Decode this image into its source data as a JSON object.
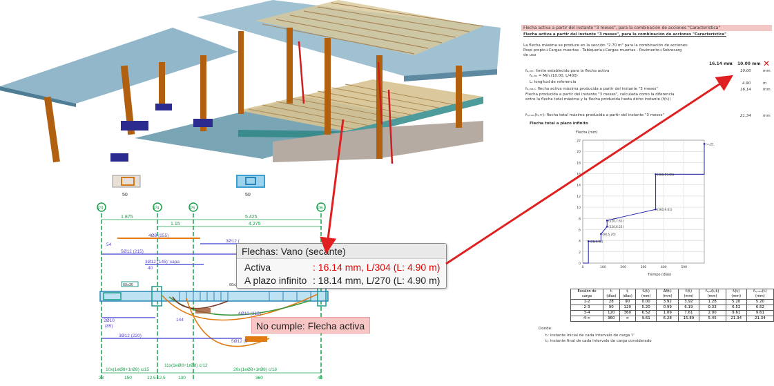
{
  "tooltip": {
    "title": "Flechas: Vano (secante)",
    "rows": [
      {
        "label": "Activa",
        "value": ": 16.14 mm, L/304 (L: 4.90 m)",
        "color": "#e00000"
      },
      {
        "label": "A plazo infinito",
        "value": ": 18.14 mm, L/270 (L: 4.90 m)",
        "color": "#222222"
      }
    ]
  },
  "status_badge": "No cumple: Flecha activa",
  "report": {
    "header": "Flecha activa a partir del instante \"3 meses\", para la combinación de acciones \"Característica\"",
    "subtitle": "Flecha activa a partir del instante \"3 meses\", para la combinación de acciones \"Característica\"",
    "intro_1": "La flecha máxima se produce en la sección \"2.70 m\" para la combinación de acciones:",
    "intro_2": "Peso propio+Cargas muertas - Tabiquería+Cargas muertas - Pavimento+Sobrecarg",
    "intro_3": "de uso",
    "check_left": "16.14 mm",
    "check_op": "≤",
    "check_right": "10.00 mm",
    "fail_mark": "✕",
    "lines": [
      "fₐ,ₗᵢₘ: límite establecido para la flecha activa",
      "fₐ,ₗᵢₘ = Mín.(10.00, L/400)",
      "L: longitud de referencia",
      "fₐ,ₘₐₓ: flecha activa máxima producida a partir del instante \"3 meses\"",
      "Flecha producida a partir del instante \"3 meses\", calculada como la diferencia",
      "entre la flecha total máxima y la flecha producida hasta dicho instante (f(tᵢ))",
      "fₜ,ₘₐₓ(tᵢ,∞): flecha total máxima producida a partir del instante \"3 meses\"",
      "Flecha total a plazo infinito"
    ],
    "right_vals": [
      "10.00",
      "4.90",
      "16.14",
      "21.34"
    ],
    "right_units": [
      "mm",
      "m",
      "mm",
      "mm"
    ],
    "chart_ylabel": "Flecha (mm)",
    "chart_xlabel": "Tiempo (días)",
    "footer_1": "Donde:",
    "footer_2": "tᵢ: instante inicial de cada intervalo de carga 'i'",
    "footer_3": "tⱼ: instante final de cada intervalo de carga considerado"
  },
  "chart_data": {
    "type": "line",
    "title": "",
    "xlabel": "Tiempo (días)",
    "ylabel": "Flecha (mm)",
    "xlim": [
      0,
      600
    ],
    "ylim": [
      0,
      22
    ],
    "xticks": [
      0,
      100,
      200,
      300,
      400,
      500
    ],
    "yticks": [
      0,
      2,
      4,
      6,
      8,
      10,
      12,
      14,
      16,
      18,
      20,
      22
    ],
    "series": [
      {
        "values": [
          [
            0,
            0
          ],
          [
            28,
            0
          ],
          [
            28,
            3.92
          ],
          [
            90,
            3.92
          ],
          [
            90,
            5.2
          ],
          [
            120,
            6.52
          ],
          [
            120,
            7.61
          ],
          [
            200,
            8.3
          ],
          [
            360,
            9.61
          ],
          [
            360,
            15.89
          ],
          [
            600,
            15.89
          ],
          [
            600,
            21.34
          ]
        ]
      }
    ],
    "labels": [
      {
        "x": 28,
        "y": 3.92,
        "text": "(28,3.92)"
      },
      {
        "x": 90,
        "y": 5.2,
        "text": "(90,5.20)"
      },
      {
        "x": 120,
        "y": 6.52,
        "text": "(120,6.52)"
      },
      {
        "x": 120,
        "y": 7.61,
        "text": "(120,7.61)"
      },
      {
        "x": 360,
        "y": 9.61,
        "text": "(360,9.61)"
      },
      {
        "x": 360,
        "y": 15.89,
        "text": "(360,15.89)"
      },
      {
        "x": 600,
        "y": 21.34,
        "text": "(∞,21.34)"
      }
    ]
  },
  "steps_table": {
    "headers": [
      "Escalón de carga",
      "tᵢ (días)",
      "tⱼ (días)",
      "fₐ(tᵢ) (mm)",
      "Δf(tᵢ) (mm)",
      "fᵢ(tⱼ) (mm)",
      "fₐ,ₐᵢ(tᵢ,tⱼ) (mm)",
      "fₜ(tⱼ) (mm)",
      "fₐ,ₘₐₓ(tᵢ) (mm)"
    ],
    "rows": [
      [
        "1-2",
        "28",
        "90",
        "0.00",
        "3.92",
        "3.92",
        "1.28",
        "5.20",
        "5.20"
      ],
      [
        "2-3",
        "90",
        "120",
        "5.20",
        "0.99",
        "6.19",
        "0.33",
        "6.52",
        "6.52"
      ],
      [
        "3-4",
        "120",
        "360",
        "6.52",
        "1.09",
        "7.61",
        "2.00",
        "9.61",
        "9.61"
      ],
      [
        "4-∞",
        "360",
        "∞",
        "9.61",
        "6.28",
        "15.89",
        "5.45",
        "21.34",
        "21.34"
      ]
    ]
  },
  "beam_drawing": {
    "column_labels": [
      "P3",
      "P4",
      "P5",
      "P6"
    ],
    "top_dims": [
      "1.875",
      "5.425",
      "1.15",
      "4.275"
    ],
    "rebar_labels": [
      "4Ø8 (255)",
      "3Ø12 (",
      "5Ø12 (215)",
      "3Ø12 (145)' capa",
      "54",
      "40",
      "2Ø10",
      "(85)",
      "144",
      "4Ø10 (315)",
      "5Ø12 (5",
      "3Ø12 (220)",
      "60x30",
      "60x30"
    ],
    "bottom_labels": [
      "10x(1eØ8+1rØ8) c/15",
      "11x(1eØ8+1rØ8) c/12",
      "20x(1eØ8+1rØ8) c/18"
    ],
    "bottom_dims": [
      "23",
      "150",
      "12.5",
      "12.5",
      "130",
      "360",
      "40"
    ],
    "section_dims": [
      "50",
      "30",
      "50",
      "30"
    ]
  },
  "colors": {
    "accent_fail": "#e01818",
    "arrow": "#e02020",
    "badge_bg": "#f9c6c6",
    "header_bg": "#f4c7c7"
  }
}
